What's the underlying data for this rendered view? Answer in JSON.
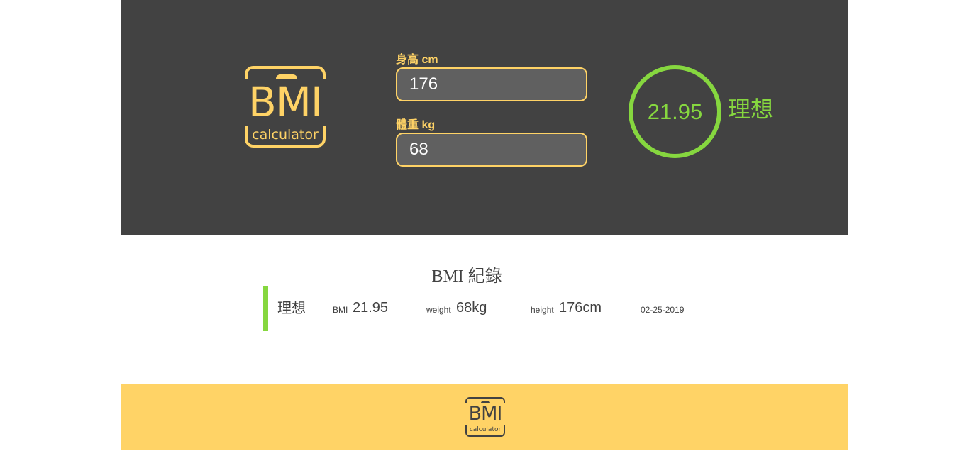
{
  "header": {
    "logo": {
      "main": "BMI",
      "sub": "calculator"
    },
    "height": {
      "label": "身高 cm",
      "value": "176"
    },
    "weight": {
      "label": "體重 kg",
      "value": "68"
    },
    "result": {
      "value": "21.95",
      "status": "理想"
    }
  },
  "records": {
    "title": "BMI 紀錄",
    "items": [
      {
        "status": "理想",
        "bmi_label": "BMI",
        "bmi": "21.95",
        "weight_label": "weight",
        "weight": "68kg",
        "height_label": "height",
        "height": "176cm",
        "date": "02-25-2019"
      }
    ]
  },
  "footer": {
    "logo": {
      "main": "BMI",
      "sub": "calculator"
    }
  },
  "colors": {
    "accent": "#ffd366",
    "dark": "#424242",
    "input_bg": "#606060",
    "ideal": "#86d73f"
  }
}
